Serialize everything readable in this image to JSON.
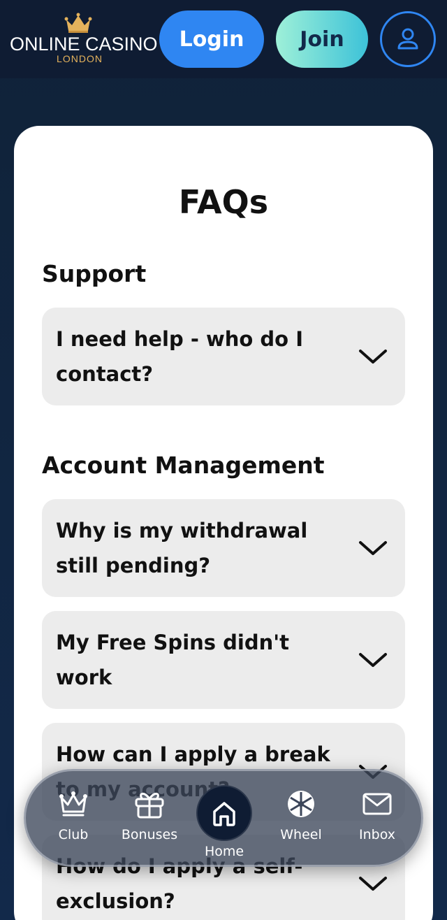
{
  "header": {
    "logo_brand": "ONLINE CASINO",
    "logo_sub": "LONDON",
    "login_label": "Login",
    "join_label": "Join",
    "profile_icon": "user-icon"
  },
  "main": {
    "title": "FAQs",
    "sections": [
      {
        "title": "Support",
        "items": [
          {
            "question": "I need help - who do I contact?"
          }
        ]
      },
      {
        "title": "Account Management",
        "items": [
          {
            "question": "Why is my withdrawal still pending?"
          },
          {
            "question": "My Free Spins didn't work"
          },
          {
            "question": "How can I apply a break to my account?"
          },
          {
            "question": "How do I apply a self-exclusion?"
          }
        ]
      }
    ]
  },
  "bottom_nav": {
    "items": [
      {
        "label": "Club",
        "icon": "crown-icon"
      },
      {
        "label": "Bonuses",
        "icon": "gift-icon"
      },
      {
        "label": "Home",
        "icon": "home-icon"
      },
      {
        "label": "Wheel",
        "icon": "wheel-icon"
      },
      {
        "label": "Inbox",
        "icon": "mail-icon"
      }
    ]
  },
  "colors": {
    "accent_blue": "#2f86f2",
    "join_gradient_start": "#9ef0d8",
    "join_gradient_end": "#3dc2d8",
    "header_bg": "#0f1c33",
    "logo_gold": "#e4b25c",
    "faq_item_bg": "#ececec"
  }
}
